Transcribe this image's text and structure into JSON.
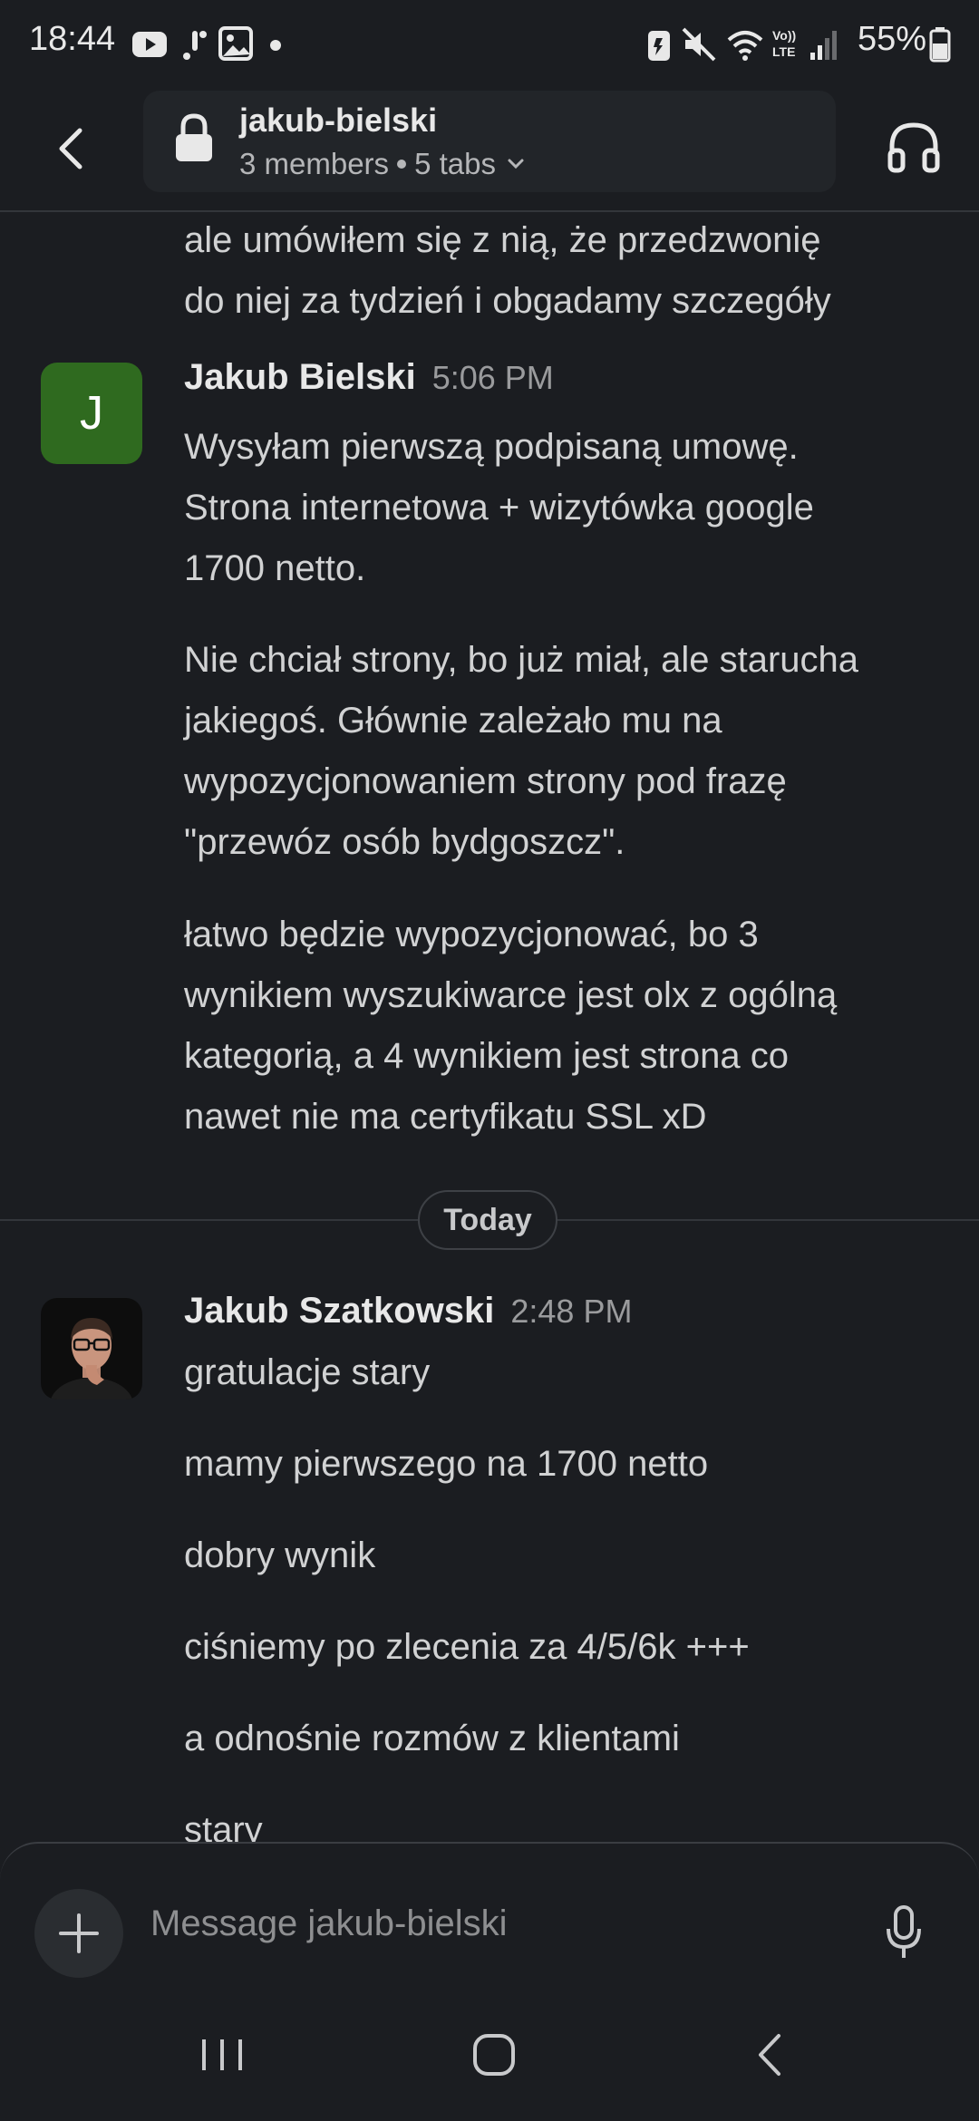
{
  "status_bar": {
    "time": "18:44",
    "battery": "55%"
  },
  "header": {
    "channel_name": "jakub-bielski",
    "members": "3 members",
    "tabs": "5 tabs"
  },
  "messages": {
    "continued_lines": [
      "ale umówiłem się z nią, że przedzwonię",
      "do niej za tydzień i obgadamy szczegóły"
    ],
    "msg1": {
      "avatar_letter": "J",
      "author": "Jakub Bielski",
      "time": "5:06 PM",
      "p1": [
        "Wysyłam pierwszą podpisaną umowę.",
        "Strona internetowa + wizytówka google",
        "1700 netto."
      ],
      "p2": [
        "Nie chciał strony, bo już miał, ale starucha",
        "jakiegoś. Głównie zależało mu na",
        "wypozycjonowaniem strony pod frazę",
        "\"przewóz osób bydgoszcz\"."
      ],
      "p3": [
        "łatwo będzie wypozycjonować, bo 3",
        "wynikiem wyszukiwarce jest olx z ogólną",
        "kategorią, a 4 wynikiem jest strona co",
        "nawet nie ma certyfikatu SSL xD"
      ]
    },
    "date_divider": "Today",
    "msg2": {
      "author": "Jakub Szatkowski",
      "time": "2:48 PM",
      "lines": [
        "gratulacje stary",
        "mamy pierwszego na 1700 netto",
        "dobry wynik",
        "ciśniemy po zlecenia za 4/5/6k +++",
        "a odnośnie rozmów z klientami",
        "stary"
      ]
    }
  },
  "composer": {
    "placeholder": "Message jakub-bielski"
  },
  "icons": {
    "back": "chevron-left-icon",
    "lock": "lock-icon",
    "headphones": "headphones-icon",
    "plus": "plus-icon",
    "mic": "microphone-icon"
  },
  "colors": {
    "background": "#1b1d21",
    "avatar_j": "#2f6a1f"
  }
}
